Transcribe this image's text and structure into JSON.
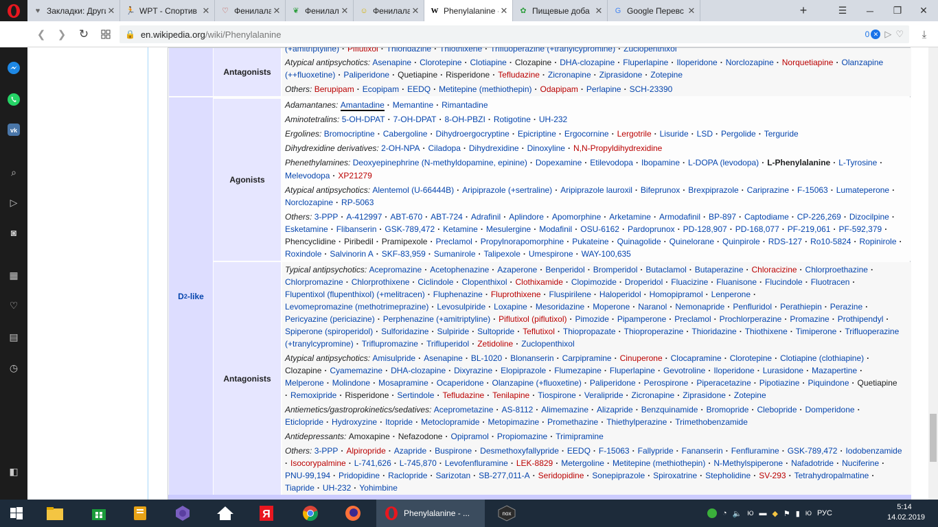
{
  "browser": {
    "tabs": [
      {
        "label": "Закладки: Други",
        "icon": "heart-icon",
        "color": "#666666"
      },
      {
        "label": "WPT - Спортив",
        "icon": "runner-icon",
        "color": "#2a6e2a"
      },
      {
        "label": "Фенилаланин:",
        "icon": "heart-circle-icon",
        "color": "#c0392b"
      },
      {
        "label": "Фенилаланин [",
        "icon": "leaf-icon",
        "color": "#2e9e3e"
      },
      {
        "label": "Фенилаланин: ",
        "icon": "smiley-icon",
        "color": "#d4b000"
      },
      {
        "label": "Phenylalanine -",
        "icon": "wikipedia-icon",
        "color": "#000000",
        "active": true
      },
      {
        "label": "Пищевые доба",
        "icon": "clover-icon",
        "color": "#2e9e3e"
      },
      {
        "label": "Google Перевс",
        "icon": "translate-icon",
        "color": "#4285f4"
      }
    ],
    "new_tab": "+",
    "url_domain": "en.wikipedia.org",
    "url_path": "/wiki/Phenylalanine",
    "badge_count": "0",
    "accent_color": "#e8171f"
  },
  "navbox": {
    "top_group": {
      "label": "Antagonists"
    },
    "top_lines": {
      "l0": [
        "(+amitriptyline)",
        "Piflutixol",
        "Thioridazine",
        "Thiothixene",
        "Trifluoperazine (+tranylcypromine)",
        "Zuclopenthixol"
      ],
      "l1_label": "Atypical antipsychotics:",
      "l1": [
        "Asenapine",
        "Clorotepine",
        "Clotiapine",
        "Clozapine",
        "DHA-clozapine",
        "Fluperlapine",
        "Iloperidone",
        "Norclozapine",
        "Norquetiapine",
        "Olanzapine"
      ],
      "l2": [
        "(++fluoxetine)",
        "Paliperidone",
        "Quetiapine",
        "Risperidone",
        "Tefludazine",
        "Zicronapine",
        "Ziprasidone",
        "Zotepine"
      ],
      "l3_label": "Others:",
      "l3": [
        "Berupipam",
        "Ecopipam",
        "EEDQ",
        "Metitepine (methiothepin)",
        "Odapipam",
        "Perlapine",
        "SCH-23390"
      ]
    },
    "d2_label": "D",
    "d2_sub": "2",
    "d2_suffix": "-like",
    "agonists": {
      "label": "Agonists",
      "adamantanes_label": "Adamantanes:",
      "adamantanes": [
        "Amantadine",
        "Memantine",
        "Rimantadine"
      ],
      "aminotetralins_label": "Aminotetralins:",
      "aminotetralins": [
        "5-OH-DPAT",
        "7-OH-DPAT",
        "8-OH-PBZI",
        "Rotigotine",
        "UH-232"
      ],
      "ergolines_label": "Ergolines:",
      "ergolines": [
        "Bromocriptine",
        "Cabergoline",
        "Dihydroergocryptine",
        "Epicriptine",
        "Ergocornine",
        "Lergotrile",
        "Lisuride",
        "LSD",
        "Pergolide",
        "Terguride"
      ],
      "dihydrexidine_label": "Dihydrexidine derivatives:",
      "dihydrexidine": [
        "2-OH-NPA",
        "Ciladopa",
        "Dihydrexidine",
        "Dinoxyline",
        "N,N-Propyldihydrexidine"
      ],
      "phenethylamines_label": "Phenethylamines:",
      "phenethylamines_1": [
        "Deoxyepinephrine (N-methyldopamine, epinine)",
        "Dopexamine",
        "Etilevodopa",
        "Ibopamine",
        "L-DOPA (levodopa)",
        "L-Phenylalanine",
        "L-Tyrosine"
      ],
      "phenethylamines_2": [
        "Melevodopa",
        "XP21279"
      ],
      "atypical_label": "Atypical antipsychotics:",
      "atypical_1": [
        "Alentemol (U-66444B)",
        "Aripiprazole (+sertraline)",
        "Aripiprazole lauroxil",
        "Bifeprunox",
        "Brexpiprazole",
        "Cariprazine",
        "F-15063",
        "Lumateperone"
      ],
      "atypical_2": [
        "Norclozapine",
        "RP-5063"
      ],
      "others_label": "Others:",
      "others_1": [
        "3-PPP",
        "A-412997",
        "ABT-670",
        "ABT-724",
        "Adrafinil",
        "Aplindore",
        "Apomorphine",
        "Arketamine",
        "Armodafinil",
        "BP-897",
        "Captodiame",
        "CP-226,269",
        "Dizocilpine"
      ],
      "others_2": [
        "Esketamine",
        "Flibanserin",
        "GSK-789,472",
        "Ketamine",
        "Mesulergine",
        "Modafinil",
        "OSU-6162",
        "Pardoprunox",
        "PD-128,907",
        "PD-168,077",
        "PF-219,061",
        "PF-592,379"
      ],
      "others_3": [
        "Phencyclidine",
        "Piribedil",
        "Pramipexole",
        "Preclamol",
        "Propylnorapomorphine",
        "Pukateine",
        "Quinagolide",
        "Quinelorane",
        "Quinpirole",
        "RDS-127",
        "Ro10-5824",
        "Ropinirole"
      ],
      "others_4": [
        "Roxindole",
        "Salvinorin A",
        "SKF-83,959",
        "Sumanirole",
        "Talipexole",
        "Umespirone",
        "WAY-100,635"
      ]
    },
    "antagonists": {
      "label": "Antagonists",
      "typical_label": "Typical antipsychotics:",
      "typical_1": [
        "Acepromazine",
        "Acetophenazine",
        "Azaperone",
        "Benperidol",
        "Bromperidol",
        "Butaclamol",
        "Butaperazine",
        "Chloracizine",
        "Chlorproethazine"
      ],
      "typical_2": [
        "Chlorpromazine",
        "Chlorprothixene",
        "Ciclindole",
        "Clopenthixol",
        "Clothixamide",
        "Clopimozide",
        "Droperidol",
        "Fluacizine",
        "Fluanisone",
        "Flucindole",
        "Fluotracen"
      ],
      "typical_3": [
        "Flupentixol (flupenthixol) (+melitracen)",
        "Fluphenazine",
        "Fluprothixene",
        "Fluspirilene",
        "Haloperidol",
        "Homopipramol",
        "Lenperone"
      ],
      "typical_4": [
        "Levomepromazine (methotrimeprazine)",
        "Levosulpiride",
        "Loxapine",
        "Mesoridazine",
        "Moperone",
        "Naranol",
        "Nemonapride",
        "Penfluridol",
        "Perathiepin",
        "Perazine"
      ],
      "typical_5": [
        "Pericyazine (periciazine)",
        "Perphenazine (+amitriptyline)",
        "Piflutixol (piflutixol)",
        "Pimozide",
        "Pipamperone",
        "Preclamol",
        "Prochlorperazine",
        "Promazine",
        "Prothipendyl"
      ],
      "typical_6": [
        "Spiperone (spiroperidol)",
        "Sulforidazine",
        "Sulpiride",
        "Sultopride",
        "Teflutixol",
        "Thiopropazate",
        "Thioproperazine",
        "Thioridazine",
        "Thiothixene",
        "Timiperone",
        "Trifluoperazine"
      ],
      "typical_7": [
        "(+tranylcypromine)",
        "Triflupromazine",
        "Trifluperidol",
        "Zetidoline",
        "Zuclopenthixol"
      ],
      "atypical_label": "Atypical antipsychotics:",
      "atypical_1": [
        "Amisulpride",
        "Asenapine",
        "BL-1020",
        "Blonanserin",
        "Carpipramine",
        "Cinuperone",
        "Clocapramine",
        "Clorotepine",
        "Clotiapine (clothiapine)"
      ],
      "atypical_2": [
        "Clozapine",
        "Cyamemazine",
        "DHA-clozapine",
        "Dixyrazine",
        "Elopiprazole",
        "Flumezapine",
        "Fluperlapine",
        "Gevotroline",
        "Iloperidone",
        "Lurasidone",
        "Mazapertine"
      ],
      "atypical_3": [
        "Melperone",
        "Molindone",
        "Mosapramine",
        "Ocaperidone",
        "Olanzapine (+fluoxetine)",
        "Paliperidone",
        "Perospirone",
        "Piperacetazine",
        "Pipotiazine",
        "Piquindone",
        "Quetiapine"
      ],
      "atypical_4": [
        "Remoxipride",
        "Risperidone",
        "Sertindole",
        "Tefludazine",
        "Tenilapine",
        "Tiospirone",
        "Veralipride",
        "Zicronapine",
        "Ziprasidone",
        "Zotepine"
      ],
      "antiemetics_label": "Antiemetics/gastroprokinetics/sedatives:",
      "antiemetics_1": [
        "Aceprometazine",
        "AS-8112",
        "Alimemazine",
        "Alizapride",
        "Benzquinamide",
        "Bromopride",
        "Clebopride",
        "Domperidone"
      ],
      "antiemetics_2": [
        "Eticlopride",
        "Hydroxyzine",
        "Itopride",
        "Metoclopramide",
        "Metopimazine",
        "Promethazine",
        "Thiethylperazine",
        "Trimethobenzamide"
      ],
      "antidepressants_label": "Antidepressants:",
      "antidepressants": [
        "Amoxapine",
        "Nefazodone",
        "Opipramol",
        "Propiomazine",
        "Trimipramine"
      ],
      "others_label": "Others:",
      "others_1": [
        "3-PPP",
        "Alpiropride",
        "Azapride",
        "Buspirone",
        "Desmethoxyfallypride",
        "EEDQ",
        "F-15063",
        "Fallypride",
        "Fananserin",
        "Fenfluramine",
        "GSK-789,472",
        "Iodobenzamide"
      ],
      "others_2": [
        "Isocorypalmine",
        "L-741,626",
        "L-745,870",
        "Levofenfluramine",
        "LEK-8829",
        "Metergoline",
        "Metitepine (methiothepin)",
        "N-Methylspiperone",
        "Nafadotride",
        "Nuciferine"
      ],
      "others_3": [
        "PNU-99,194",
        "Pridopidine",
        "Raclopride",
        "Sarizotan",
        "SB-277,011-A",
        "Seridopidine",
        "Sonepiprazole",
        "Spiroxatrine",
        "Stepholidine",
        "SV-293",
        "Tetrahydropalmatine"
      ],
      "others_4": [
        "Tiapride",
        "UH-232",
        "Yohimbine"
      ]
    },
    "red_links": [
      "Piflutixol",
      "Norquetiapine",
      "Tefludazine",
      "Berupipam",
      "Odapipam",
      "Lergotrile",
      "N,N-Propyldihydrexidine",
      "XP21279",
      "Chloracizine",
      "Clothixamide",
      "Fluprothixene",
      "Piflutixol (piflutixol)",
      "Teflutixol",
      "Zetidoline",
      "Cinuperone",
      "Tenilapine",
      "Alpiropride",
      "Isocorypalmine",
      "LEK-8829",
      "Seridopidine",
      "SV-293"
    ],
    "visited_links": [
      "Clozapine",
      "Quetiapine",
      "Risperidone",
      "Piribedil",
      "Pramipexole",
      "Amoxapine",
      "Nefazodone",
      "Phencyclidine"
    ],
    "bold_items": [
      "L-Phenylalanine"
    ]
  },
  "taskbar": {
    "active_label": "Phenylalanine - ...",
    "lang": "РУС",
    "time": "5:14",
    "date": "14.02.2019"
  }
}
